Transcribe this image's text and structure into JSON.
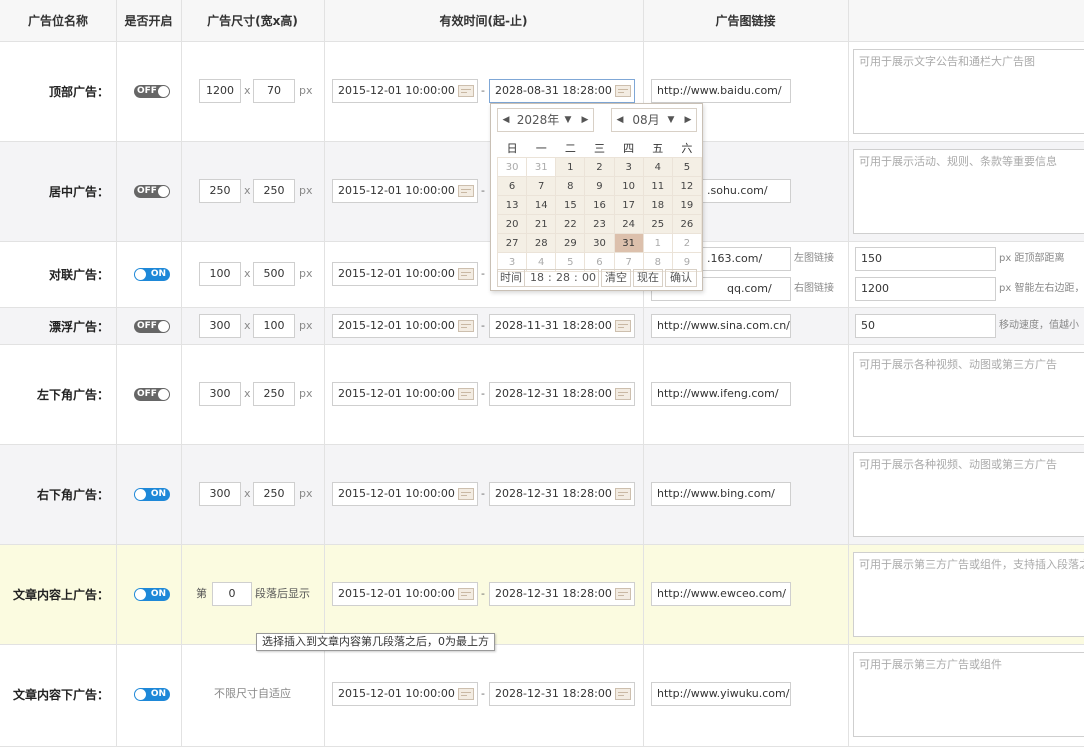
{
  "headers": {
    "name": "广告位名称",
    "enabled": "是否开启",
    "size": "广告尺寸(宽x高)",
    "time": "有效时间(起-止)",
    "link": "广告图链接"
  },
  "toggle_labels": {
    "on": "ON",
    "off": "OFF"
  },
  "units": {
    "x": "x",
    "px": "px",
    "dash": "-"
  },
  "rows": [
    {
      "label": "顶部广告：",
      "state": "off",
      "w": "1200",
      "h": "70",
      "start": "2015-12-01 10:00:00",
      "end": "2028-08-31 18:28:00",
      "link": "http://www.baidu.com/",
      "note": "可用于展示文字公告和通栏大广告图"
    },
    {
      "label": "居中广告：",
      "state": "off",
      "w": "250",
      "h": "250",
      "start": "2015-12-01 10:00:00",
      "end": "",
      "link": ".sohu.com/",
      "note": "可用于展示活动、规则、条款等重要信息"
    },
    {
      "label": "对联广告：",
      "state": "on",
      "w": "100",
      "h": "500",
      "start": "2015-12-01 10:00:00",
      "end": "",
      "link": ".163.com/",
      "link2": "qq.com/",
      "link_label": "左图链接",
      "link2_label": "右图链接",
      "top_dist": "150",
      "top_dist_label": "px 距顶部距离",
      "side_dist": "1200",
      "side_dist_label": "px 智能左右边距，"
    },
    {
      "label": "漂浮广告：",
      "state": "off",
      "w": "300",
      "h": "100",
      "start": "2015-12-01 10:00:00",
      "end": "2028-11-31 18:28:00",
      "link": "http://www.sina.com.cn/",
      "speed": "50",
      "speed_label": "移动速度，值越小"
    },
    {
      "label": "左下角广告：",
      "state": "off",
      "w": "300",
      "h": "250",
      "start": "2015-12-01 10:00:00",
      "end": "2028-12-31 18:28:00",
      "link": "http://www.ifeng.com/",
      "note": "可用于展示各种视频、动图或第三方广告"
    },
    {
      "label": "右下角广告：",
      "state": "on",
      "w": "300",
      "h": "250",
      "start": "2015-12-01 10:00:00",
      "end": "2028-12-31 18:28:00",
      "link": "http://www.bing.com/",
      "note": "可用于展示各种视频、动图或第三方广告"
    },
    {
      "label": "文章内容上广告：",
      "state": "on",
      "para_prefix": "第",
      "para_value": "0",
      "para_suffix": "段落后显示",
      "start": "2015-12-01 10:00:00",
      "end": "2028-12-31 18:28:00",
      "link": "http://www.ewceo.com/",
      "note": "可用于展示第三方广告或组件，支持插入段落之后"
    },
    {
      "label": "文章内容下广告：",
      "state": "on",
      "size_text": "不限尺寸自适应",
      "start": "2015-12-01 10:00:00",
      "end": "2028-12-31 18:28:00",
      "link": "http://www.yiwuku.com/",
      "note": "可用于展示第三方广告或组件"
    }
  ],
  "tooltip": "选择插入到文章内容第几段落之后，0为最上方",
  "calendar": {
    "year": "2028年",
    "month": "08月",
    "weekdays": [
      "日",
      "一",
      "二",
      "三",
      "四",
      "五",
      "六"
    ],
    "weeks": [
      [
        "30",
        "31",
        "1",
        "2",
        "3",
        "4",
        "5"
      ],
      [
        "6",
        "7",
        "8",
        "9",
        "10",
        "11",
        "12"
      ],
      [
        "13",
        "14",
        "15",
        "16",
        "17",
        "18",
        "19"
      ],
      [
        "20",
        "21",
        "22",
        "23",
        "24",
        "25",
        "26"
      ],
      [
        "27",
        "28",
        "29",
        "30",
        "31",
        "1",
        "2"
      ],
      [
        "3",
        "4",
        "5",
        "6",
        "7",
        "8",
        "9"
      ]
    ],
    "selected_day": "31",
    "time_label": "时间",
    "hour": "18",
    "minute": "28",
    "second": "00",
    "clear": "清空",
    "now": "现在",
    "confirm": "确认"
  }
}
